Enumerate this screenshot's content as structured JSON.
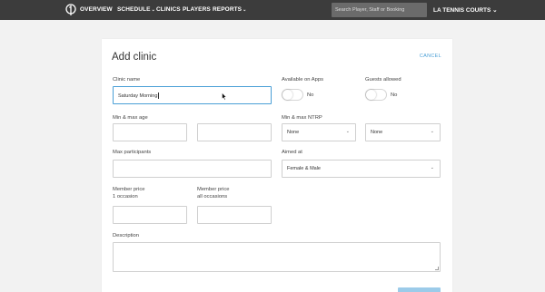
{
  "nav": {
    "items": [
      "OVERVIEW",
      "SCHEDULE",
      "CLINICS",
      "PLAYERS",
      "REPORTS"
    ],
    "search_placeholder": "Search Player, Staff or Booking",
    "club": "LA TENNIS COURTS"
  },
  "form": {
    "title": "Add clinic",
    "cancel": "CANCEL",
    "clinic_name_label": "Clinic name",
    "clinic_name_value": "Saturday Morning",
    "available_apps_label": "Available on Apps",
    "available_apps_value": "No",
    "guests_label": "Guests allowed",
    "guests_value": "No",
    "age_label": "Min & max age",
    "ntrp_label": "Min & max NTRP",
    "ntrp_min": "None",
    "ntrp_max": "None",
    "max_participants_label": "Max participants",
    "aimed_at_label": "Aimed at",
    "aimed_at_value": "Female & Male",
    "member_price_label_1": "Member price",
    "member_price_label_2": "1 occasion",
    "member_price_all_label_1": "Member price",
    "member_price_all_label_2": "all occasions",
    "description_label": "Description"
  }
}
